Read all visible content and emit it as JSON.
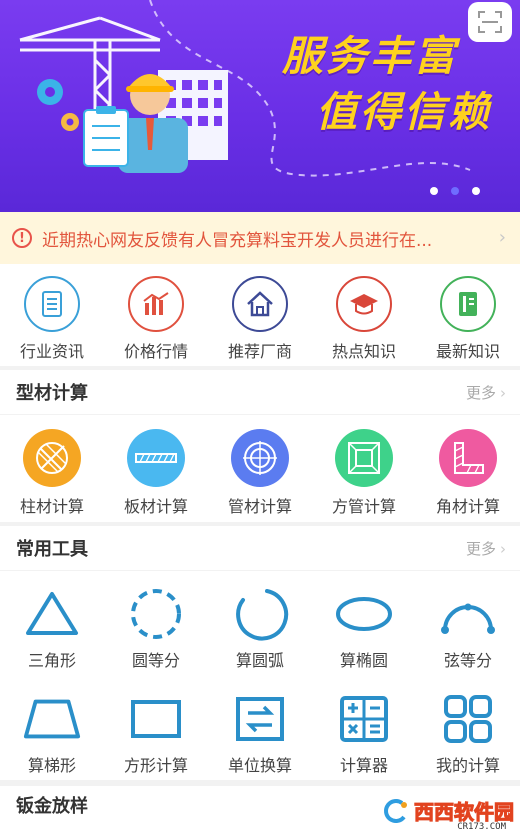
{
  "banner": {
    "headline_line1": "服务丰富",
    "headline_line2": "值得信赖",
    "scan_icon": "scan-icon",
    "carousel_total": 3,
    "carousel_active": 2
  },
  "notice": {
    "text": "近期热心网友反馈有人冒充算料宝开发人员进行在..."
  },
  "quick_nav": [
    {
      "label": "行业资讯",
      "icon": "document-icon",
      "color": "#3aa0d8"
    },
    {
      "label": "价格行情",
      "icon": "bar-chart-icon",
      "color": "#e0513f"
    },
    {
      "label": "推荐厂商",
      "icon": "house-icon",
      "color": "#3d4a96"
    },
    {
      "label": "热点知识",
      "icon": "graduation-cap-icon",
      "color": "#d9473a"
    },
    {
      "label": "最新知识",
      "icon": "book-icon",
      "color": "#43b25a"
    }
  ],
  "section_material": {
    "title": "型材计算",
    "more": "更多",
    "items": [
      {
        "label": "柱材计算",
        "icon": "column-icon",
        "color": "#f5a623"
      },
      {
        "label": "板材计算",
        "icon": "plate-icon",
        "color": "#4ab8f0"
      },
      {
        "label": "管材计算",
        "icon": "pipe-icon",
        "color": "#5b7cf0"
      },
      {
        "label": "方管计算",
        "icon": "square-tube-icon",
        "color": "#3ed28a"
      },
      {
        "label": "角材计算",
        "icon": "angle-icon",
        "color": "#ef5aa0"
      }
    ]
  },
  "section_tools": {
    "title": "常用工具",
    "more": "更多",
    "items": [
      {
        "label": "三角形",
        "icon": "triangle-icon"
      },
      {
        "label": "圆等分",
        "icon": "dashed-circle-icon"
      },
      {
        "label": "算圆弧",
        "icon": "arc-icon"
      },
      {
        "label": "算椭圆",
        "icon": "ellipse-icon"
      },
      {
        "label": "弦等分",
        "icon": "chord-icon"
      },
      {
        "label": "算梯形",
        "icon": "trapezoid-icon"
      },
      {
        "label": "方形计算",
        "icon": "rectangle-icon"
      },
      {
        "label": "单位换算",
        "icon": "swap-icon"
      },
      {
        "label": "计算器",
        "icon": "calculator-icon"
      },
      {
        "label": "我的计算",
        "icon": "grid-icon"
      }
    ]
  },
  "section_sheet": {
    "title": "钣金放样"
  },
  "watermark": {
    "text": "西西软件园",
    "sub": "CR173.COM"
  },
  "colors": {
    "tool_blue": "#2a8fc9",
    "notice_text": "#e2553d",
    "headline": "#ffd21e"
  }
}
